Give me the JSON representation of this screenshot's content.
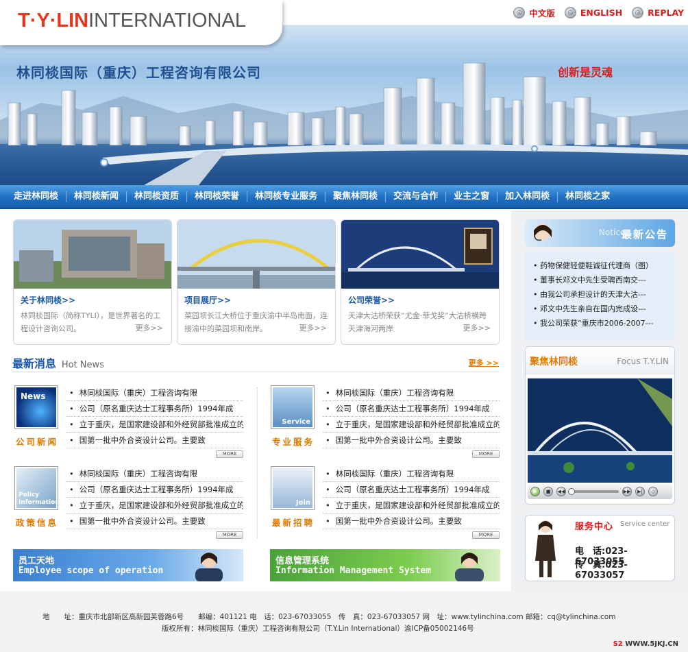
{
  "header": {
    "logo_brand": "T·Y·LIN",
    "logo_rest": "INTERNATIONAL",
    "company_name": "林同棪国际（重庆）工程咨询有限公司",
    "slogan": "创新是灵魂",
    "lang": [
      "中文版",
      "ENGLISH",
      "REPLAY"
    ]
  },
  "nav": [
    "走进林同棪",
    "林同棪新闻",
    "林同棪资质",
    "林同棪荣誉",
    "林同棪专业服务",
    "聚焦林同棪",
    "交流与合作",
    "业主之窗",
    "加入林同棪",
    "林同棪之家"
  ],
  "features": [
    {
      "title": "关于林同棪>>",
      "text": "林同棪国际（简称TYLI），是世界著名的工程设计咨询公司。",
      "more": "更多>>"
    },
    {
      "title": "项目展厅>>",
      "text": "菜园坝长江大桥位于重庆渝中半岛南面，连接渝中的菜园坝和南岸。",
      "more": "更多>>"
    },
    {
      "title": "公司荣誉>>",
      "text": "天津大沽桥荣获“尤金·菲戈奖”大沽桥横跨天津海河两岸",
      "more": "更多>>"
    }
  ],
  "news": {
    "title": "最新消息",
    "title_en": "Hot News",
    "more": "更多 >>",
    "more_btn": "MORE",
    "blocks": [
      {
        "label": "公司新闻",
        "thumb_caption": "News",
        "items": [
          "林同棪国际（重庆）工程咨询有限",
          "公司（原名重庆达士工程事务所）1994年成",
          "立于重庆，是国家建设部和外经贸部批准成立的",
          "国第一批中外合资设计公司。主要致"
        ]
      },
      {
        "label": "专业服务",
        "thumb_caption": "Service",
        "items": [
          "林同棪国际（重庆）工程咨询有限",
          "公司（原名重庆达士工程事务所）1994年成",
          "立于重庆，是国家建设部和外经贸部批准成立的",
          "国第一批中外合资设计公司。主要致"
        ]
      },
      {
        "label": "政策信息",
        "thumb_caption": "Policy Information",
        "items": [
          "林同棪国际（重庆）工程咨询有限",
          "公司（原名重庆达士工程事务所）1994年成",
          "立于重庆，是国家建设部和外经贸部批准成立的",
          "国第一批中外合资设计公司。主要致"
        ]
      },
      {
        "label": "最新招聘",
        "thumb_caption": "Join",
        "items": [
          "林同棪国际（重庆）工程咨询有限",
          "公司（原名重庆达士工程事务所）1994年成",
          "立于重庆，是国家建设部和外经贸部批准成立的",
          "国第一批中外合资设计公司。主要致"
        ]
      }
    ]
  },
  "banners": [
    {
      "line1": "员工天地",
      "line2": "Employee scope of operation"
    },
    {
      "line1": "信息管理系统",
      "line2": "Information Management System"
    }
  ],
  "notice": {
    "title": "最新公告",
    "en": "Notice",
    "items": [
      "药物保健轻便鞋诚征代理商（图）",
      "董事长邓文中先生受聘西南交---",
      "由我公司承担设计的天津大沽---",
      "邓文中先生亲自在国内完成设---",
      "我公司荣获“重庆市2006-2007---"
    ]
  },
  "focus": {
    "title": "聚焦林同棪",
    "title_en": "Focus T.Y.LIN"
  },
  "service": {
    "title": "服务中心",
    "title_en": "Service center",
    "tel": "电　话:023-67033055",
    "fax": "传　真:023-67033057"
  },
  "footer": {
    "line1": "地　　址：重庆市北部新区高新园芙蓉路6号　　邮编：401121 电　话：023-67033055　传　真：023-67033057 网　址：www.tylinchina.com 邮箱：cq@tylinchina.com",
    "line2": "版权所有：林同棪国际（重庆）工程咨询有限公司（T.Y.Lin International）渝ICP备05002146号"
  },
  "watermark": "WWW.5JKJ.CN",
  "colors": {
    "nav_blue": "#1f6fc2",
    "accent_orange": "#e07a00",
    "brand_red": "#e6371e",
    "title_blue": "#1a56a8"
  }
}
